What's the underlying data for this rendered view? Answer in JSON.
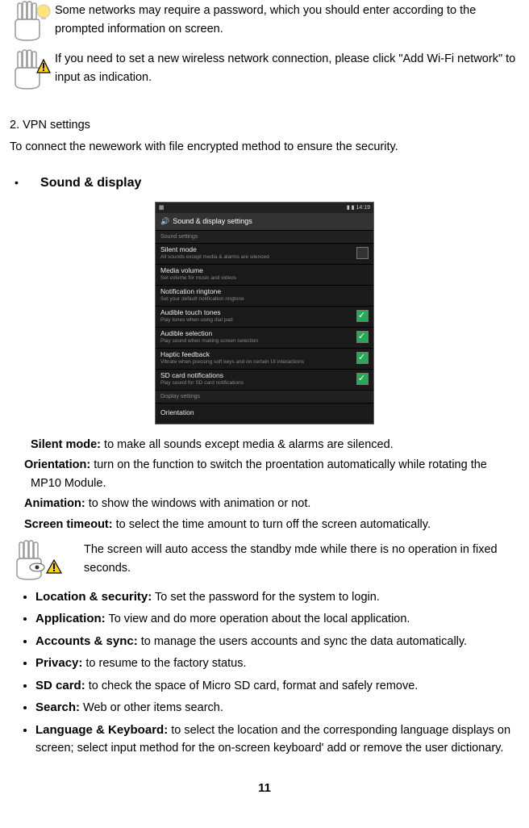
{
  "notes": {
    "n1": "Some networks may require a password, which you should enter according to the prompted information on screen.",
    "n2": "If you need to set a new wireless network connection, please click \"Add Wi-Fi network\" to input as indication."
  },
  "vpn": {
    "heading": "2. VPN settings",
    "body": "To connect the newework with file encrypted method to ensure the security."
  },
  "sound_display": {
    "heading": "Sound & display",
    "screenshot": {
      "status_time": "14:19",
      "title": "Sound & display settings",
      "section_sound": "Sound settings",
      "section_display": "Display settings",
      "rows": [
        {
          "title": "Silent mode",
          "sub": "All sounds except media & alarms are silenced",
          "checked": false
        },
        {
          "title": "Media volume",
          "sub": "Set volume for music and videos",
          "checked": null
        },
        {
          "title": "Notification ringtone",
          "sub": "Set your default notification ringtone",
          "checked": null
        },
        {
          "title": "Audible touch tones",
          "sub": "Play tones when using dial pad",
          "checked": true
        },
        {
          "title": "Audible selection",
          "sub": "Play sound when making screen selection",
          "checked": true
        },
        {
          "title": "Haptic feedback",
          "sub": "Vibrate when pressing soft keys and on certain UI interactions",
          "checked": true
        },
        {
          "title": "SD card notifications",
          "sub": "Play sound for SD card notifications",
          "checked": true
        }
      ],
      "row_orientation": {
        "title": "Orientation",
        "sub": ""
      }
    },
    "desc": {
      "silent_label": "Silent mode:",
      "silent_text": " to make all sounds except media & alarms are silenced.",
      "orientation_label": "Orientation:",
      "orientation_text": " turn on the function to switch the proentation automatically while rotating the MP10 Module.",
      "animation_label": "Animation:",
      "animation_text": " to show the windows with animation or not.",
      "timeout_label": "Screen timeout:",
      "timeout_text": " to select the time amount to turn off the screen automatically."
    },
    "standby_note": "The screen will auto access the standby mde while there is no operation in fixed seconds."
  },
  "features": {
    "location_label": "Location & security:",
    "location_text": " To set the password for the system to login.",
    "application_label": "Application:",
    "application_text": " To view and do more operation about the local application.",
    "accounts_label": "Accounts & sync:",
    "accounts_text": " to manage the users accounts and sync the data automatically.",
    "privacy_label": "Privacy:",
    "privacy_text": " to resume to the factory status.",
    "sd_label": "SD card:",
    "sd_text": " to check the space of Micro SD card, format and safely remove.",
    "search_label": "Search:",
    "search_text": " Web or other items search.",
    "lang_label": "Language & Keyboard:",
    "lang_text": " to select the location and the corresponding language displays on screen; select input method for the on-screen keyboard' add or remove the user dictionary."
  },
  "page_number": "11"
}
